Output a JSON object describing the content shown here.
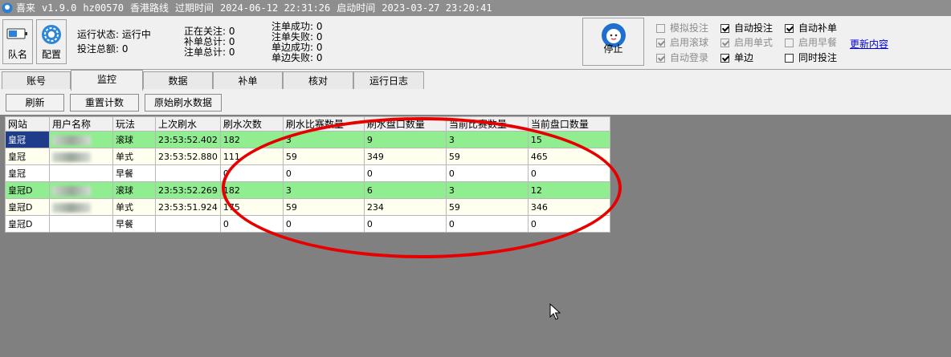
{
  "title": {
    "app": "喜来",
    "version": "v1.9.0",
    "id": "hz00570",
    "route": "香港路线",
    "expire_label": "过期时间",
    "expire_time": "2024-06-12 22:31:26",
    "start_label": "启动时间",
    "start_time": "2023-03-27 23:20:41"
  },
  "toolbar": {
    "team_label": "队名",
    "config_label": "配置",
    "stop_label": "停止",
    "status": {
      "run_state": "运行状态: 运行中",
      "bet_total": "投注总额: 0",
      "watching": "正在关注: 0",
      "fill_total": "补单总计: 0",
      "order_total": "注单总计: 0",
      "order_success": "注单成功: 0",
      "order_fail": "注单失败: 0",
      "single_success": "单边成功: 0",
      "single_fail": "单边失败: 0"
    },
    "checks": [
      {
        "label": "模拟投注",
        "checked": false,
        "disabled": true
      },
      {
        "label": "自动投注",
        "checked": true,
        "disabled": false
      },
      {
        "label": "自动补单",
        "checked": true,
        "disabled": false
      },
      {
        "label": "启用滚球",
        "checked": true,
        "disabled": true
      },
      {
        "label": "启用单式",
        "checked": true,
        "disabled": true
      },
      {
        "label": "启用早餐",
        "checked": false,
        "disabled": true
      },
      {
        "label": "自动登录",
        "checked": true,
        "disabled": true
      },
      {
        "label": "单边",
        "checked": true,
        "disabled": false
      },
      {
        "label": "同时投注",
        "checked": false,
        "disabled": false
      }
    ],
    "update_link": "更新内容"
  },
  "tabs": [
    {
      "label": "账号",
      "active": false
    },
    {
      "label": "监控",
      "active": true
    },
    {
      "label": "数据",
      "active": false
    },
    {
      "label": "补单",
      "active": false
    },
    {
      "label": "核对",
      "active": false
    },
    {
      "label": "运行日志",
      "active": false
    }
  ],
  "actions": {
    "refresh": "刷新",
    "reset_count": "重置计数",
    "raw_data": "原始刷水数据"
  },
  "table": {
    "headers": [
      "网站",
      "用户名称",
      "玩法",
      "上次刷水",
      "刷水次数",
      "刷水比赛数量",
      "刷水盘口数量",
      "当前比赛数量",
      "当前盘口数量"
    ],
    "rows": [
      {
        "site": "皇冠",
        "user": "",
        "play": "滚球",
        "last": "23:53:52.402",
        "count": "182",
        "match": "3",
        "odds": "9",
        "cur_match": "3",
        "cur_odds": "15",
        "color": "g"
      },
      {
        "site": "皇冠",
        "user": "",
        "play": "单式",
        "last": "23:53:52.880",
        "count": "111",
        "match": "59",
        "odds": "349",
        "cur_match": "59",
        "cur_odds": "465",
        "color": "y"
      },
      {
        "site": "皇冠",
        "user": "",
        "play": "早餐",
        "last": "",
        "count": "0",
        "match": "0",
        "odds": "0",
        "cur_match": "0",
        "cur_odds": "0",
        "color": "w"
      },
      {
        "site": "皇冠D",
        "user": "",
        "play": "滚球",
        "last": "23:53:52.269",
        "count": "182",
        "match": "3",
        "odds": "6",
        "cur_match": "3",
        "cur_odds": "12",
        "color": "g"
      },
      {
        "site": "皇冠D",
        "user": "",
        "play": "单式",
        "last": "23:53:51.924",
        "count": "175",
        "match": "59",
        "odds": "234",
        "cur_match": "59",
        "cur_odds": "346",
        "color": "y"
      },
      {
        "site": "皇冠D",
        "user": "",
        "play": "早餐",
        "last": "",
        "count": "0",
        "match": "0",
        "odds": "0",
        "cur_match": "0",
        "cur_odds": "0",
        "color": "w"
      }
    ]
  },
  "colors": {
    "row_green": "#90ee90",
    "row_yellow": "#fffff0",
    "selection": "#1e3c8a",
    "annotation_circle": "#e60000"
  }
}
